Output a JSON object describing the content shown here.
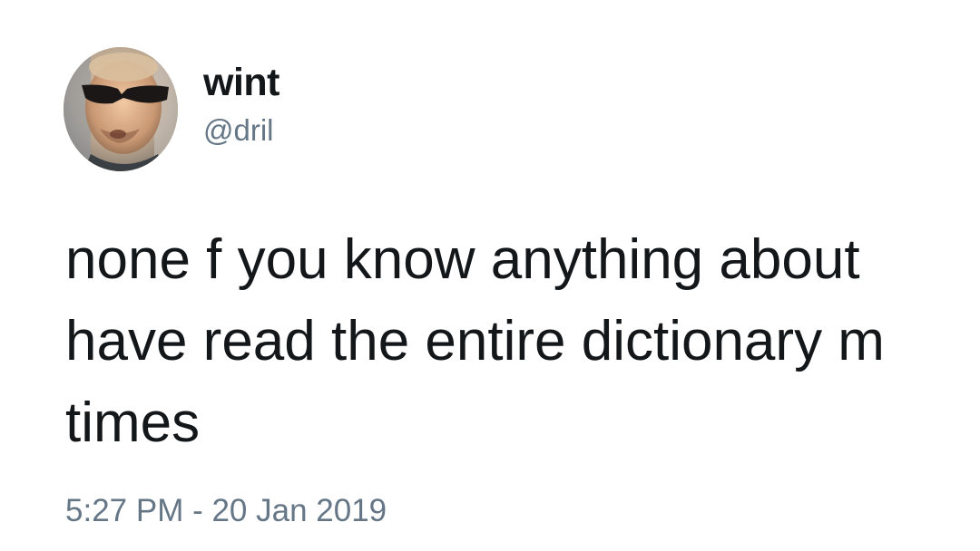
{
  "author": {
    "display_name": "wint",
    "handle": "@dril",
    "avatar_icon": "user-avatar-photo"
  },
  "tweet": {
    "lines": [
      "none f you know anything about",
      "have read the entire dictionary m",
      "times"
    ],
    "timestamp": "5:27 PM - 20 Jan 2019"
  },
  "colors": {
    "text": "#14171a",
    "secondary": "#657786",
    "background": "#ffffff"
  }
}
